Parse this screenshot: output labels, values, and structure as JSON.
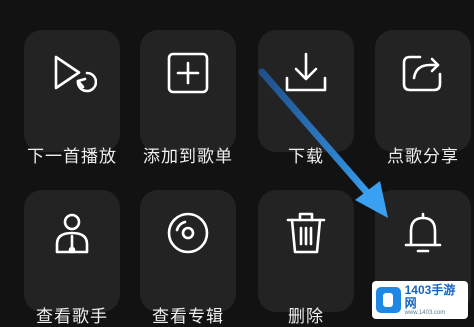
{
  "menu": {
    "items": [
      {
        "label": "下一首播放",
        "icon": "play-next-icon"
      },
      {
        "label": "添加到歌单",
        "icon": "add-to-playlist-icon"
      },
      {
        "label": "下载",
        "icon": "download-icon"
      },
      {
        "label": "点歌分享",
        "icon": "share-icon"
      },
      {
        "label": "查看歌手",
        "icon": "singer-icon"
      },
      {
        "label": "查看专辑",
        "icon": "album-icon"
      },
      {
        "label": "删除",
        "icon": "trash-icon"
      },
      {
        "label": "",
        "icon": "bell-icon"
      }
    ]
  },
  "watermark": {
    "title": "1403手游网",
    "subtitle": "www.1403.com"
  },
  "colors": {
    "background": "#121212",
    "tile": "#232323",
    "icon": "#ffffff",
    "label": "#eeeeee",
    "arrow": "#2f8fe6"
  }
}
